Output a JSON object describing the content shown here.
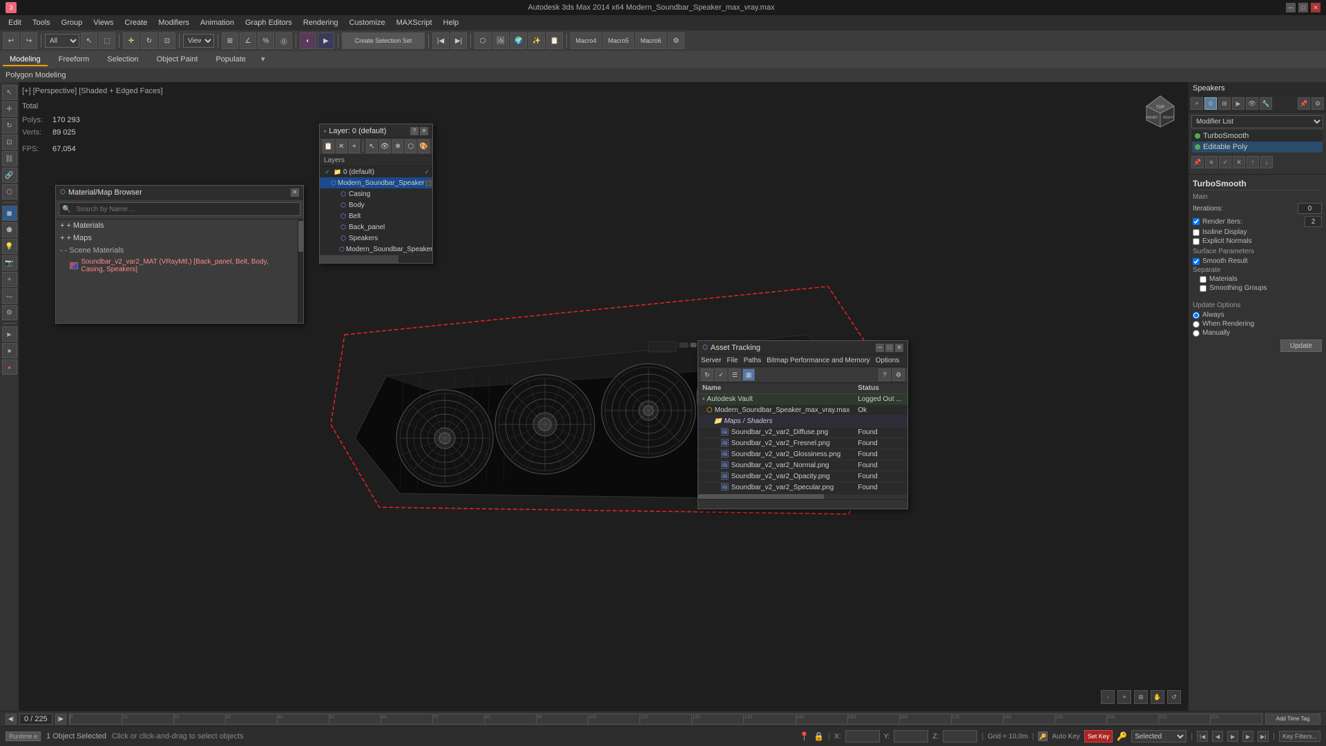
{
  "titlebar": {
    "title": "Autodesk 3ds Max  2014 x64    Modern_Soundbar_Speaker_max_vray.max",
    "minimize": "─",
    "maximize": "□",
    "close": "✕"
  },
  "menubar": {
    "items": [
      "Edit",
      "Tools",
      "Group",
      "Views",
      "Create",
      "Modifiers",
      "Animation",
      "Graph Editors",
      "Rendering",
      "Customize",
      "MAXScript",
      "Help"
    ]
  },
  "secondary_tabs": {
    "items": [
      "Modeling",
      "Freeform",
      "Selection",
      "Object Paint",
      "Populate"
    ],
    "active": "Modeling"
  },
  "polygon_bar": {
    "label": "Polygon Modeling"
  },
  "viewport": {
    "label": "[+] [Perspective] [Shaded + Edged Faces]",
    "stats": {
      "total_label": "Total",
      "polys_label": "Polys:",
      "polys_value": "170 293",
      "verts_label": "Verts:",
      "verts_value": "89 025",
      "fps_label": "FPS:",
      "fps_value": "67,054"
    }
  },
  "layer_window": {
    "title": "Layer: 0 (default)",
    "header": "Layers",
    "items": [
      {
        "indent": 0,
        "name": "0 (default)",
        "type": "layer",
        "expanded": true,
        "checked": true
      },
      {
        "indent": 1,
        "name": "Modern_Soundbar_Speaker",
        "type": "object",
        "selected": true
      },
      {
        "indent": 2,
        "name": "Casing",
        "type": "mesh"
      },
      {
        "indent": 2,
        "name": "Body",
        "type": "mesh"
      },
      {
        "indent": 2,
        "name": "Belt",
        "type": "mesh"
      },
      {
        "indent": 2,
        "name": "Back_panel",
        "type": "mesh"
      },
      {
        "indent": 2,
        "name": "Speakers",
        "type": "mesh"
      },
      {
        "indent": 2,
        "name": "Modern_Soundbar_Speaker",
        "type": "mesh"
      }
    ]
  },
  "material_window": {
    "title": "Material/Map Browser",
    "search_placeholder": "Search by Name ...",
    "sections": {
      "materials": "+ Materials",
      "maps": "+ Maps",
      "scene_materials": "- Scene Materials"
    },
    "scene_material": "Soundbar_v2_var2_MAT (VRayMtl.) [Back_panel, Belt, Body, Casing, Speakers]"
  },
  "right_panel": {
    "header": "Speakers",
    "modifier_list_label": "Modifier List",
    "modifiers": [
      {
        "name": "TurboSmooth",
        "dot": "green"
      },
      {
        "name": "Editable Poly",
        "dot": "green"
      }
    ],
    "turbosmooth": {
      "title": "TurboSmooth",
      "main_label": "Main",
      "iterations_label": "Iterations:",
      "iterations_value": "0",
      "render_iters_label": "Render Iters:",
      "render_iters_value": "2",
      "isoline_display": "Isoline Display",
      "explicit_normals": "Explicit Normals",
      "surface_params_label": "Surface Parameters",
      "smooth_result": "Smooth Result",
      "separate_label": "Separate",
      "materials_label": "Materials",
      "smoothing_groups_label": "Smoothing Groups",
      "update_options_label": "Update Options",
      "always_label": "Always",
      "when_rendering_label": "When Rendering",
      "manually_label": "Manually",
      "update_btn": "Update"
    }
  },
  "asset_window": {
    "title": "Asset Tracking",
    "menu_items": [
      "Server",
      "File",
      "Paths",
      "Bitmap Performance and Memory",
      "Options"
    ],
    "columns": [
      "Name",
      "Status"
    ],
    "rows": [
      {
        "indent": 0,
        "name": "Autodesk Vault",
        "status": "Logged Out ...",
        "type": "vault"
      },
      {
        "indent": 1,
        "name": "Modern_Soundbar_Speaker_max_vray.max",
        "status": "Ok",
        "type": "file"
      },
      {
        "indent": 2,
        "name": "Maps / Shaders",
        "status": "",
        "type": "group"
      },
      {
        "indent": 3,
        "name": "Soundbar_v2_var2_Diffuse.png",
        "status": "Found",
        "type": "texture"
      },
      {
        "indent": 3,
        "name": "Soundbar_v2_var2_Fresnel.png",
        "status": "Found",
        "type": "texture"
      },
      {
        "indent": 3,
        "name": "Soundbar_v2_var2_Glossiness.png",
        "status": "Found",
        "type": "texture"
      },
      {
        "indent": 3,
        "name": "Soundbar_v2_var2_Normal.png",
        "status": "Found",
        "type": "texture"
      },
      {
        "indent": 3,
        "name": "Soundbar_v2_var2_Opacity.png",
        "status": "Found",
        "type": "texture"
      },
      {
        "indent": 3,
        "name": "Soundbar_v2_var2_Specular.png",
        "status": "Found",
        "type": "texture"
      }
    ]
  },
  "timeline": {
    "frame_display": "0 / 225",
    "frame_start": "0",
    "tick_labels": [
      "0",
      "10",
      "20",
      "30",
      "40",
      "50",
      "60",
      "70",
      "80",
      "90",
      "100",
      "110",
      "120",
      "130",
      "140",
      "150",
      "160",
      "170",
      "180",
      "190",
      "200",
      "210",
      "220"
    ]
  },
  "statusbar": {
    "object_count": "1 Object Selected",
    "hint": "Click or click-and-drag to select objects",
    "grid_label": "Grid = 10,0m",
    "autokey_label": "Auto Key",
    "selection_label": "Selected",
    "keyfiler_label": "Key Filters..."
  },
  "icons": {
    "close": "✕",
    "minimize": "─",
    "maximize": "□",
    "arrow_right": "▶",
    "arrow_left": "◀",
    "arrow_down": "▼",
    "arrow_up": "▲",
    "plus": "+",
    "minus": "−",
    "question": "?",
    "eye": "👁",
    "lock": "🔒",
    "gear": "⚙",
    "folder": "📁",
    "file": "📄",
    "image": "🖼"
  }
}
